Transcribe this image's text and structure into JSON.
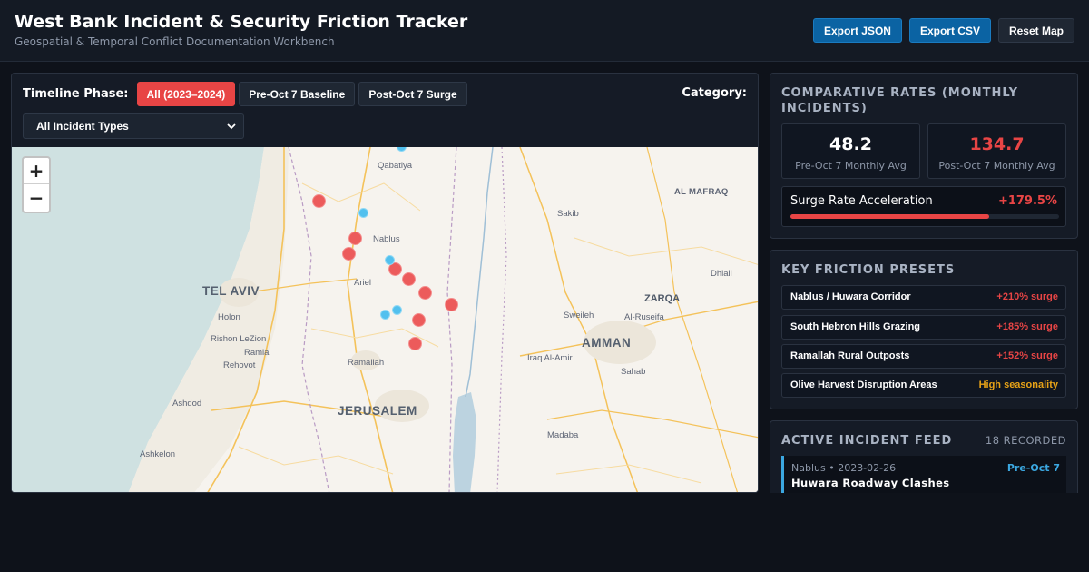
{
  "header": {
    "title": "West Bank Incident & Security Friction Tracker",
    "subtitle": "Geospatial & Temporal Conflict Documentation Workbench",
    "actions": {
      "export_json": "Export JSON",
      "export_csv": "Export CSV",
      "reset_map": "Reset Map"
    }
  },
  "filters": {
    "phase_label": "Timeline Phase:",
    "phases": [
      {
        "label": "All (2023–2024)",
        "active": true
      },
      {
        "label": "Pre-Oct 7 Baseline",
        "active": false
      },
      {
        "label": "Post-Oct 7 Surge",
        "active": false
      }
    ],
    "category_label": "Category:",
    "category_selected": "All Incident Types"
  },
  "map": {
    "zoom_in": "+",
    "zoom_out": "−",
    "places": {
      "qabatiya": "Qabatiya",
      "al_mafraq": "AL MAFRAQ",
      "sakib": "Sakib",
      "nablus": "Nablus",
      "dhlail": "Dhlail",
      "tel_aviv": "TEL AVIV",
      "ariel": "Ariel",
      "zarqa": "ZARQA",
      "holon": "Holon",
      "sweileh": "Sweileh",
      "al_ruseifa": "Al-Ruseifa",
      "rishon": "Rishon LeZion",
      "ramla": "Ramla",
      "amman": "AMMAN",
      "rehovot": "Rehovot",
      "ramallah": "Ramallah",
      "iraq_al_amir": "Iraq Al-Amir",
      "sahab": "Sahab",
      "ashdod": "Ashdod",
      "jerusalem": "JERUSALEM",
      "madaba": "Madaba",
      "ashkelon": "Ashkelon"
    },
    "legend_colors": {
      "post_oct7": "#ec5b5b",
      "pre_oct7": "#52c0ee"
    }
  },
  "rates": {
    "title": "COMPARATIVE RATES (MONTHLY INCIDENTS)",
    "pre_value": "48.2",
    "pre_label": "Pre-Oct 7 Monthly Avg",
    "post_value": "134.7",
    "post_label": "Post-Oct 7 Monthly Avg",
    "surge_label": "Surge Rate Acceleration",
    "surge_value": "+179.5%",
    "surge_fill_fraction": 0.74
  },
  "presets": {
    "title": "KEY FRICTION PRESETS",
    "items": [
      {
        "name": "Nablus / Huwara Corridor",
        "tag": "+210% surge",
        "color": "#e84545"
      },
      {
        "name": "South Hebron Hills Grazing",
        "tag": "+185% surge",
        "color": "#e84545"
      },
      {
        "name": "Ramallah Rural Outposts",
        "tag": "+152% surge",
        "color": "#e84545"
      },
      {
        "name": "Olive Harvest Disruption Areas",
        "tag": "High seasonality",
        "color": "#e8a317"
      }
    ]
  },
  "feed": {
    "title": "ACTIVE INCIDENT FEED",
    "count": "18 RECORDED",
    "items": [
      {
        "meta": "Nablus • 2023-02-26",
        "phase": "Pre-Oct 7",
        "title": "Huwara Roadway Clashes"
      }
    ]
  }
}
